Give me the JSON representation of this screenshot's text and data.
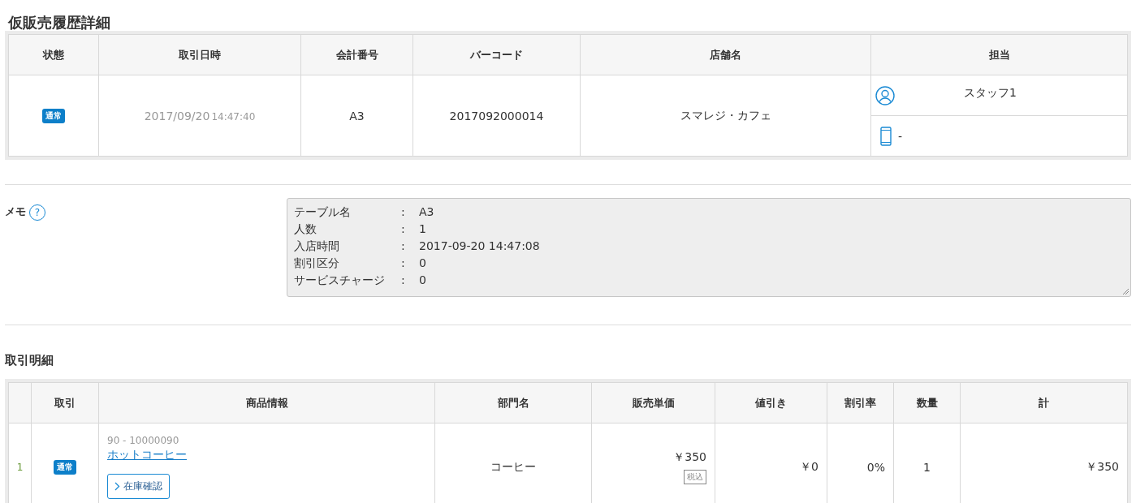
{
  "page_title": "仮販売履歴詳細",
  "summary": {
    "columns": [
      "状態",
      "取引日時",
      "会計番号",
      "バーコード",
      "店舗名",
      "担当"
    ],
    "status": "通常",
    "date": "2017/09/20",
    "time": "14:47:40",
    "account_no": "A3",
    "barcode": "2017092000014",
    "store": "スマレジ・カフェ",
    "staff": [
      {
        "kind": "person",
        "value": "スタッフ1"
      },
      {
        "kind": "device",
        "value": "-"
      }
    ]
  },
  "memo": {
    "label": "メモ",
    "help_icon": "?",
    "lines": [
      {
        "key": "テーブル名",
        "sep": ":",
        "value": "A3"
      },
      {
        "key": "人数",
        "sep": ":",
        "value": "1"
      },
      {
        "key": "入店時間",
        "sep": ":",
        "value": "2017-09-20 14:47:08"
      },
      {
        "key": "割引区分",
        "sep": ":",
        "value": "0"
      },
      {
        "key": "サービスチャージ",
        "sep": ":",
        "value": "0"
      }
    ]
  },
  "details": {
    "title": "取引明細",
    "columns": [
      "",
      "取引",
      "商品情報",
      "部門名",
      "販売単価",
      "値引き",
      "割引率",
      "数量",
      "計"
    ],
    "rows": [
      {
        "no": "1",
        "status": "通常",
        "code": "90 - 10000090",
        "name": "ホットコーヒー",
        "stock_button": "在庫確認",
        "department": "コーヒー",
        "unit_price": "￥350",
        "tax_tag": "税込",
        "discount": "￥0",
        "discount_rate": "0%",
        "quantity": "1",
        "total": "￥350"
      }
    ]
  }
}
